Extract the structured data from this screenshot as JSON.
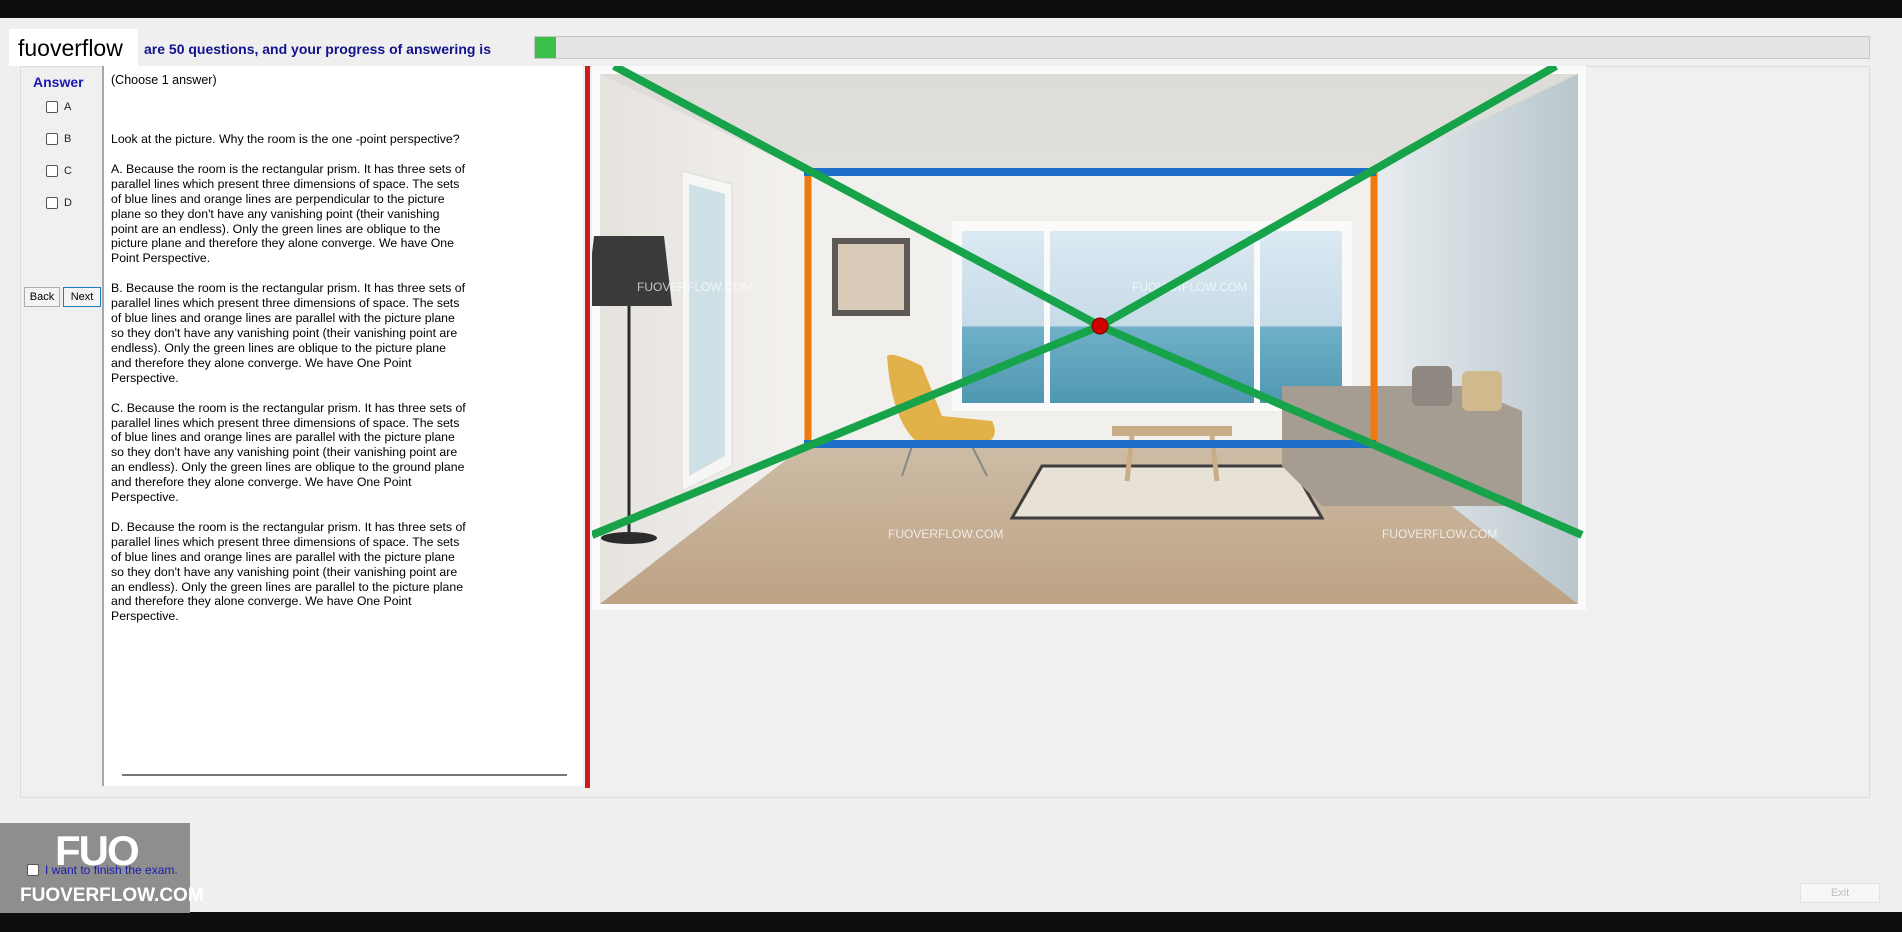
{
  "header": {
    "logo": "fuoverflow",
    "progress_text": "are 50 questions, and your progress of answering is",
    "progress_fraction": 0.016
  },
  "answer": {
    "title": "Answer",
    "options": [
      "A",
      "B",
      "C",
      "D"
    ]
  },
  "nav": {
    "back": "Back",
    "next": "Next"
  },
  "question": {
    "instruction": "(Choose 1 answer)",
    "prompt": "Look at the picture. Why the room is the one -point perspective?",
    "choices": [
      "A.  Because the room is the rectangular prism. It has three sets of parallel lines which present three dimensions of space. The sets of blue lines and orange lines are perpendicular to the picture plane so they don't have any vanishing point (their vanishing point are an endless). Only the green lines are oblique to the picture plane and therefore they alone converge. We have One Point Perspective.",
      "B.  Because the room is the rectangular prism. It has three sets of parallel lines which present three dimensions of space. The sets of blue lines and orange lines are parallel with the picture plane so they don't have any vanishing point (their vanishing point are endless). Only the green lines are oblique to the picture plane and therefore they alone converge. We have One Point Perspective.",
      "C.  Because the room is the rectangular prism. It has three sets of parallel lines which present three dimensions of space. The sets of blue lines and orange lines are parallel with the picture plane so they don't have any vanishing point (their vanishing point are an endless). Only the green lines are oblique to the ground plane and therefore they alone converge. We have One Point Perspective.",
      "D.  Because the room is the rectangular prism. It has three sets of parallel lines which present three dimensions of space. The sets of blue lines and orange lines are parallel with the picture plane so they don't have any vanishing point (their vanishing point are an endless). Only the green lines are parallel to the picture plane and therefore they alone converge. We have One Point Perspective."
    ]
  },
  "image": {
    "watermarks": [
      "FUOVERFLOW.COM",
      "FUOVERFLOW.COM",
      "FUOVERFLOW.COM",
      "FUOVERFLOW.COM"
    ],
    "colors": {
      "green": "#16a34a",
      "blue": "#1e6fc8",
      "orange": "#f07a10",
      "vanishing_point": "#d00000"
    }
  },
  "watermark": {
    "logo": "FUO",
    "site": "FUOVERFLOW.COM"
  },
  "footer": {
    "finish_label": "I want to finish the exam.",
    "exit": "Exit"
  }
}
